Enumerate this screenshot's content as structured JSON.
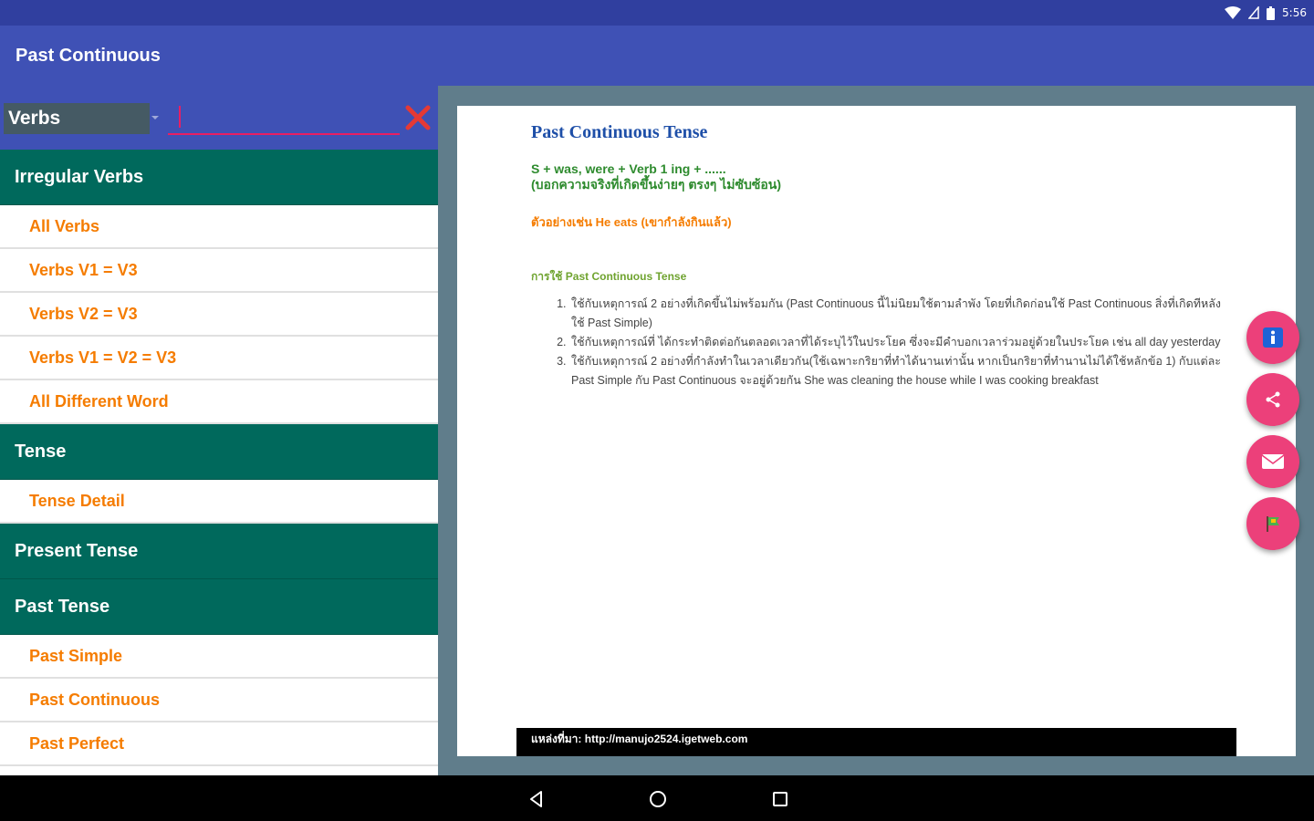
{
  "status_bar": {
    "time": "5:56"
  },
  "app_bar": {
    "title": "Past Continuous"
  },
  "search": {
    "spinner_value": "Verbs",
    "input_value": "",
    "placeholder": ""
  },
  "sidebar": {
    "sections": [
      {
        "label": "Irregular Verbs",
        "items": [
          "All Verbs",
          "Verbs V1 = V3",
          "Verbs V2 = V3",
          "Verbs V1 = V2 = V3",
          "All Different Word"
        ]
      },
      {
        "label": "Tense",
        "items": [
          "Tense Detail"
        ]
      },
      {
        "label": "Present Tense",
        "items": []
      },
      {
        "label": "Past Tense",
        "items": [
          "Past Simple",
          "Past Continuous",
          "Past Perfect"
        ]
      }
    ]
  },
  "content": {
    "title": "Past Continuous Tense",
    "formula_line1": "S + was, were + Verb 1 ing + ......",
    "formula_line2": "(บอกความจริงที่เกิดขึ้นง่ายๆ ตรงๆ ไม่ซับซ้อน)",
    "example": "ตัวอย่างเช่น He eats (เขากำลังกินแล้ว)",
    "usage_title": "การใช้ Past Continuous Tense",
    "usage_items": [
      "ใช้กับเหตุการณ์ 2 อย่างที่เกิดขึ้นไม่พร้อมกัน (Past Continuous นี้ไม่นิยมใช้ตามลำพัง โดยที่เกิดก่อนใช้ Past Continuous สิ่งที่เกิดทีหลังใช้ Past Simple)",
      "ใช้กับเหตุการณ์ที่ ได้กระทำติดต่อกันตลอดเวลาที่ได้ระบุไว้ในประโยค ซึ่งจะมีคำบอกเวลาร่วมอยู่ด้วยในประโยค เช่น all day yesterday",
      "ใช้กับเหตุการณ์ 2 อย่างที่กำลังทำในเวลาเดียวกัน(ใช้เฉพาะกริยาที่ทำได้นานเท่านั้น หากเป็นกริยาที่ทำนานไม่ได้ใช้หลักข้อ 1) กับแต่ละ Past Simple กับ Past Continuous จะอยู่ด้วยกัน She was cleaning the house while I was cooking breakfast"
    ],
    "footer": "แหล่งที่มา: http://manujo2524.igetweb.com"
  },
  "fabs": [
    {
      "icon": "info-icon",
      "color": "#EC407A"
    },
    {
      "icon": "share-icon",
      "color": "#EC407A"
    },
    {
      "icon": "mail-icon",
      "color": "#EC407A"
    },
    {
      "icon": "flag-icon",
      "color": "#EC407A"
    }
  ],
  "colors": {
    "primary": "#3F51B5",
    "primary_dark": "#303F9F",
    "section_header": "#00695C",
    "item_text": "#F57C00",
    "accent": "#E91E63"
  }
}
